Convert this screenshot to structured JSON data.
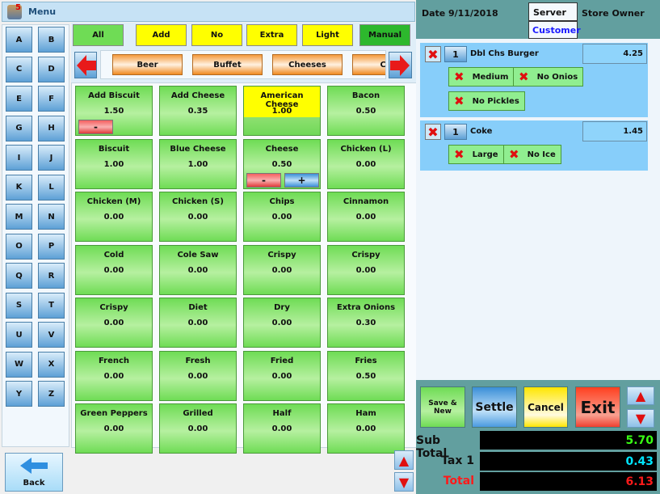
{
  "title": "Menu",
  "letters": [
    "A",
    "B",
    "C",
    "D",
    "E",
    "F",
    "G",
    "H",
    "I",
    "J",
    "K",
    "L",
    "M",
    "N",
    "O",
    "P",
    "Q",
    "R",
    "S",
    "T",
    "U",
    "V",
    "W",
    "X",
    "Y",
    "Z"
  ],
  "filters": [
    {
      "label": "All",
      "color": "#6fdc55"
    },
    {
      "label": "Add",
      "color": "#ffff00"
    },
    {
      "label": "No",
      "color": "#ffff00"
    },
    {
      "label": "Extra",
      "color": "#ffff00"
    },
    {
      "label": "Light",
      "color": "#ffff00"
    },
    {
      "label": "Manual",
      "color": "#2db82d"
    }
  ],
  "categories": [
    "Beer",
    "Buffet",
    "Cheeses",
    "Chi"
  ],
  "items": [
    {
      "name": "Add Biscuit",
      "price": "1.50",
      "minus": "-"
    },
    {
      "name": "Add Cheese",
      "price": "0.35"
    },
    {
      "name": "American Cheese",
      "price": "1.00",
      "selected": true
    },
    {
      "name": "Bacon",
      "price": "0.50"
    },
    {
      "name": "Biscuit",
      "price": "1.00"
    },
    {
      "name": "Blue Cheese",
      "price": "1.00"
    },
    {
      "name": "Cheese",
      "price": "0.50",
      "minus": "-",
      "plus": "+"
    },
    {
      "name": "Chicken (L)",
      "price": "0.00"
    },
    {
      "name": "Chicken (M)",
      "price": "0.00"
    },
    {
      "name": "Chicken (S)",
      "price": "0.00"
    },
    {
      "name": "Chips",
      "price": "0.00"
    },
    {
      "name": "Cinnamon",
      "price": "0.00"
    },
    {
      "name": "Cold",
      "price": "0.00"
    },
    {
      "name": "Cole Saw",
      "price": "0.00"
    },
    {
      "name": "Crispy",
      "price": "0.00"
    },
    {
      "name": "Crispy",
      "price": "0.00"
    },
    {
      "name": "Crispy",
      "price": "0.00"
    },
    {
      "name": "Diet",
      "price": "0.00"
    },
    {
      "name": "Dry",
      "price": "0.00"
    },
    {
      "name": "Extra Onions",
      "price": "0.30"
    },
    {
      "name": "French",
      "price": "0.00"
    },
    {
      "name": "Fresh",
      "price": "0.00"
    },
    {
      "name": "Fried",
      "price": "0.00"
    },
    {
      "name": "Fries",
      "price": "0.50"
    },
    {
      "name": "Green Peppers",
      "price": "0.00"
    },
    {
      "name": "Grilled",
      "price": "0.00"
    },
    {
      "name": "Half",
      "price": "0.00"
    },
    {
      "name": "Ham",
      "price": "0.00"
    }
  ],
  "back_label": "Back",
  "header": {
    "date_label": "Date",
    "date": "9/11/2018",
    "server_label": "Server",
    "server": "Store Owner",
    "customer_label": "Customer"
  },
  "order": [
    {
      "qty": "1",
      "name": "Dbl Chs Burger",
      "price": "4.25",
      "mods": [
        "Medium",
        "No Onios",
        "No Pickles"
      ]
    },
    {
      "qty": "1",
      "name": "Coke",
      "price": "1.45",
      "mods": [
        "Large",
        "No Ice"
      ]
    }
  ],
  "actions": {
    "save_new": "Save & New",
    "settle": "Settle",
    "cancel": "Cancel",
    "exit": "Exit"
  },
  "totals": {
    "subtotal_label": "Sub Total",
    "subtotal": "5.70",
    "tax_label": "Tax 1",
    "tax": "0.43",
    "total_label": "Total",
    "total": "6.13"
  },
  "colors": {
    "subtotal": "#39ff14",
    "tax": "#00e5ff",
    "total": "#ff1a1a"
  }
}
